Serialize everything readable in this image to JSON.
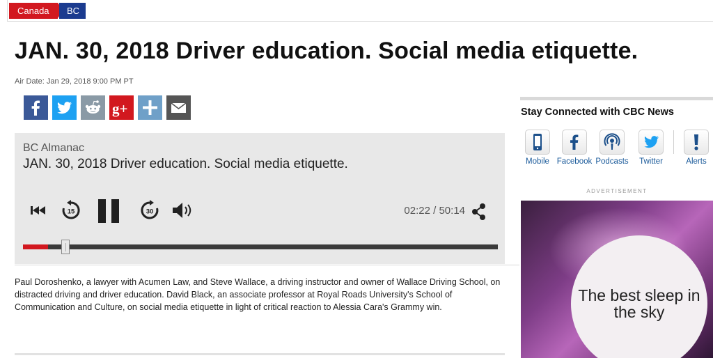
{
  "breadcrumb": {
    "items": [
      {
        "label": "Canada"
      },
      {
        "label": "BC"
      }
    ]
  },
  "page": {
    "title": "JAN. 30, 2018 Driver education. Social media etiquette.",
    "air_date": "Air Date: Jan 29, 2018 9:00 PM PT"
  },
  "share": {
    "buttons": [
      {
        "icon": "facebook-icon",
        "color": "#3b5998"
      },
      {
        "icon": "twitter-icon",
        "color": "#1da1f2"
      },
      {
        "icon": "reddit-icon",
        "color": "#8a9aa6"
      },
      {
        "icon": "google-plus-icon",
        "color": "#d2181f"
      },
      {
        "icon": "plus-icon",
        "color": "#6fa0c8"
      },
      {
        "icon": "email-icon",
        "color": "#555555"
      }
    ]
  },
  "player": {
    "show": "BC Almanac",
    "episode": "JAN. 30, 2018 Driver education. Social media etiquette.",
    "time": "02:22 / 50:14",
    "progress_fraction": 0.053,
    "skip_back_seconds": "15",
    "skip_forward_seconds": "30",
    "accent_color": "#d2181f"
  },
  "description": "Paul Doroshenko, a lawyer with Acumen Law, and Steve Wallace, a driving instructor and owner of Wallace Driving School, on distracted driving and driver education. David Black, an associate professor at Royal Roads University's School of Communication and Culture, on social media etiquette in light of critical reaction to Alessia Cara's Grammy win.",
  "sidebar": {
    "heading": "Stay Connected with CBC News",
    "links": [
      {
        "label": "Mobile",
        "icon": "mobile-icon"
      },
      {
        "label": "Facebook",
        "icon": "facebook-icon"
      },
      {
        "label": "Podcasts",
        "icon": "podcast-icon"
      },
      {
        "label": "Twitter",
        "icon": "twitter-icon"
      },
      {
        "label": "Alerts",
        "icon": "alert-icon"
      }
    ],
    "ad_label": "ADVERTISEMENT",
    "ad_text": "The best sleep in the sky",
    "link_color": "#1a5a9a"
  }
}
